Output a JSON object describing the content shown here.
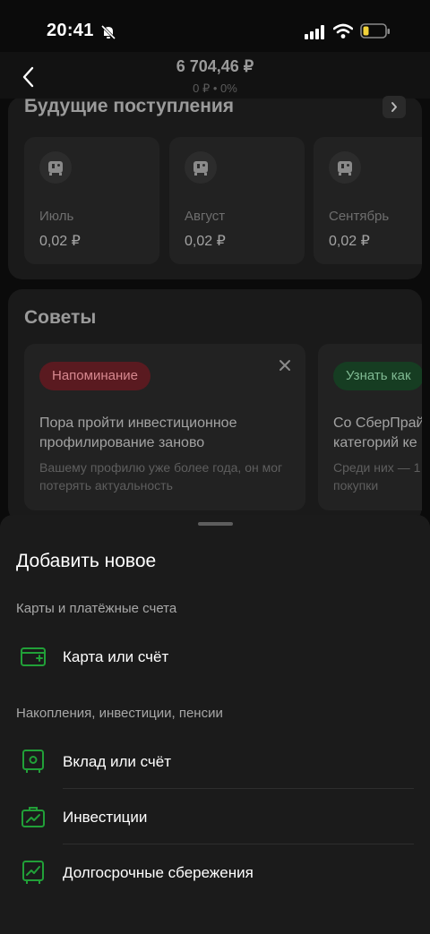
{
  "status_bar": {
    "time": "20:41",
    "icons": [
      "bell-slash-icon",
      "cellular-icon",
      "wifi-icon",
      "battery-low-icon"
    ]
  },
  "header": {
    "amount": "6 704,46 ₽",
    "change": "0 ₽ • 0%"
  },
  "upcoming": {
    "title": "Будущие поступления",
    "months": [
      {
        "name": "Июль",
        "value": "0,02 ₽"
      },
      {
        "name": "Август",
        "value": "0,02 ₽"
      },
      {
        "name": "Сентябрь",
        "value": "0,02 ₽"
      }
    ]
  },
  "tips": {
    "title": "Советы",
    "cards": [
      {
        "badge": "Напоминание",
        "text": "Пора пройти инвестиционное профилирование заново",
        "sub": "Вашему профилю уже более года, он мог потерять актуальность"
      },
      {
        "badge": "Узнать как",
        "text": "Со СберПрайм категорий ке",
        "sub": "Среди них — 1 покупки"
      }
    ]
  },
  "sheet": {
    "title": "Добавить новое",
    "sections": [
      {
        "label": "Карты и платёжные счета",
        "items": [
          {
            "label": "Карта или счёт",
            "icon": "card-add-icon"
          }
        ]
      },
      {
        "label": "Накопления, инвестиции, пенсии",
        "items": [
          {
            "label": "Вклад или счёт",
            "icon": "safe-icon"
          },
          {
            "label": "Инвестиции",
            "icon": "briefcase-chart-icon"
          },
          {
            "label": "Долгосрочные сбережения",
            "icon": "chart-box-icon"
          }
        ]
      }
    ]
  },
  "colors": {
    "accent_green": "#21a038",
    "badge_red_bg": "#5a1a20",
    "badge_green_bg": "#163d22",
    "sheet_bg": "#1b1b1b"
  }
}
